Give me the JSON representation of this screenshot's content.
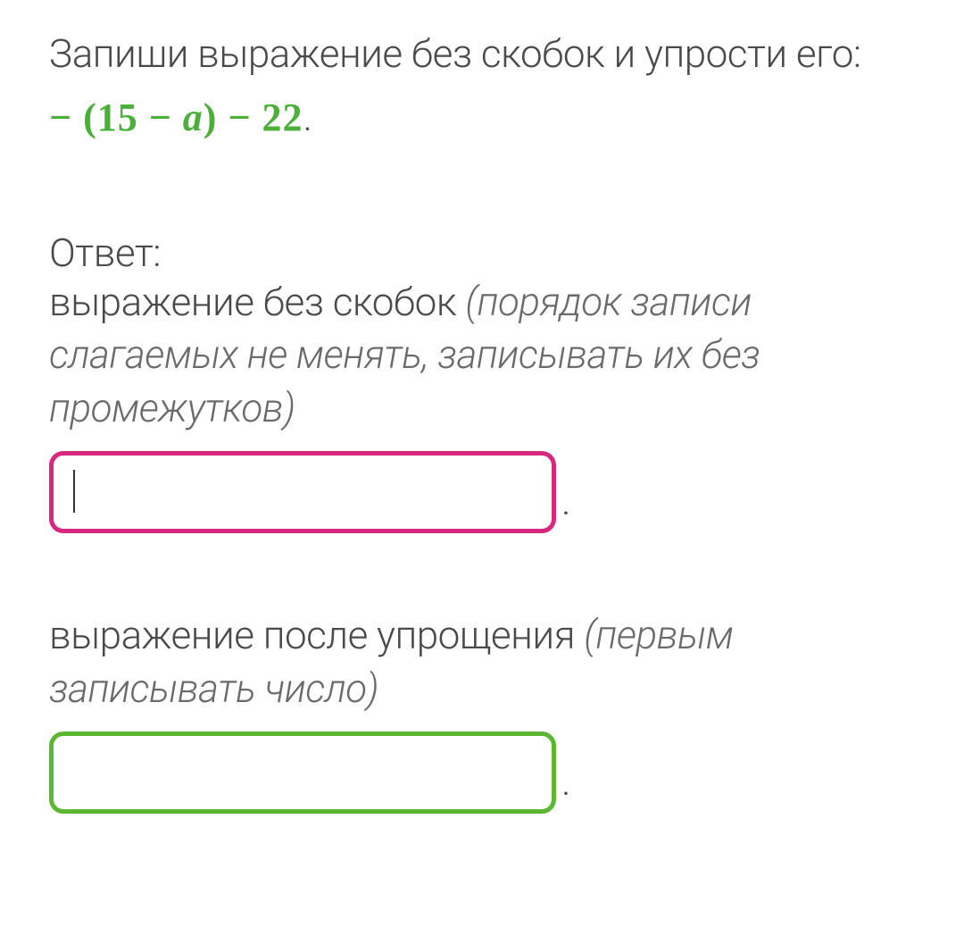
{
  "prompt": {
    "instruction": "Запиши выражение без скобок и упрости его:",
    "expression_prefix": "− (15 − ",
    "expression_var": "a",
    "expression_suffix": ") − 22",
    "expression_end": "."
  },
  "answer": {
    "label": "Ответ:",
    "part1_text": "выражение без скобок ",
    "part1_hint": "(порядок записи слагаемых не менять, записывать их без промежутков)",
    "input1_value": "",
    "part2_text": "выражение после упрощения ",
    "part2_hint": "(первым записывать число)",
    "input2_value": ""
  },
  "punctuation": {
    "period": "."
  }
}
